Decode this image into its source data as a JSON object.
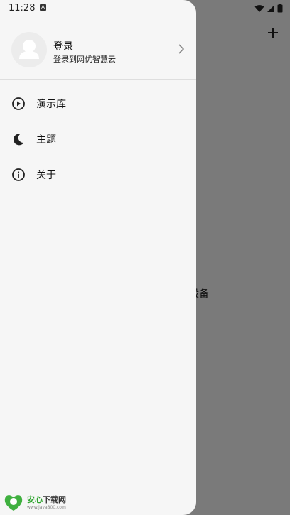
{
  "status_bar": {
    "time": "11:28",
    "sim_label": "A"
  },
  "background": {
    "visible_text": "到设备"
  },
  "profile": {
    "name": "登录",
    "subtitle": "登录到网优智慧云"
  },
  "menu": [
    {
      "label": "演示库",
      "icon": "play-circle-icon"
    },
    {
      "label": "主题",
      "icon": "moon-icon"
    },
    {
      "label": "关于",
      "icon": "info-icon"
    }
  ],
  "watermark": {
    "title_part1": "安心",
    "title_part2": "下载网",
    "url": "www.java800.com"
  }
}
